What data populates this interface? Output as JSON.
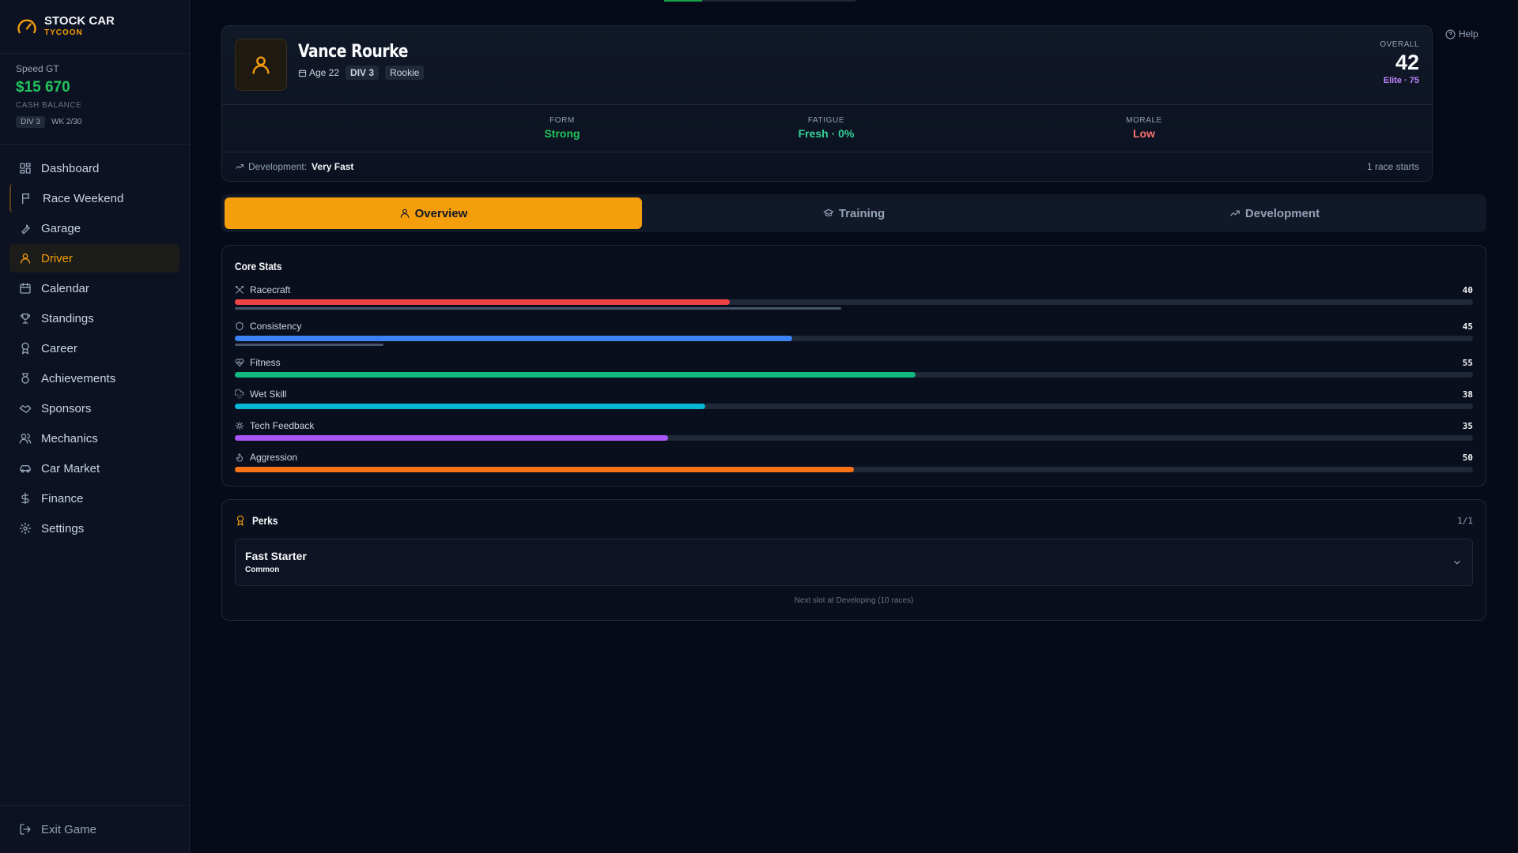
{
  "app": {
    "title": "STOCK CAR",
    "subtitle": "TYCOON"
  },
  "account": {
    "team": "Speed GT",
    "cash": "$15 670",
    "cash_label": "CASH BALANCE",
    "division": "DIV 3",
    "week": "WK 2/30"
  },
  "nav": [
    {
      "label": "Dashboard",
      "icon": "dashboard-icon"
    },
    {
      "label": "Race Weekend",
      "icon": "flag-icon"
    },
    {
      "label": "Garage",
      "icon": "wrench-icon"
    },
    {
      "label": "Driver",
      "icon": "user-icon",
      "active": true
    },
    {
      "label": "Calendar",
      "icon": "calendar-icon"
    },
    {
      "label": "Standings",
      "icon": "trophy-icon"
    },
    {
      "label": "Career",
      "icon": "award-icon"
    },
    {
      "label": "Achievements",
      "icon": "medal-icon"
    },
    {
      "label": "Sponsors",
      "icon": "handshake-icon"
    },
    {
      "label": "Mechanics",
      "icon": "users-icon"
    },
    {
      "label": "Car Market",
      "icon": "car-icon"
    },
    {
      "label": "Finance",
      "icon": "dollar-icon"
    },
    {
      "label": "Settings",
      "icon": "gear-icon"
    }
  ],
  "exit_label": "Exit Game",
  "help_label": "Help",
  "driver": {
    "name": "Vance Rourke",
    "age": "Age 22",
    "division": "DIV 3",
    "status": "Rookie",
    "overall_label": "OVERALL",
    "overall": "42",
    "tier": "Elite · 75",
    "form_label": "FORM",
    "form": "Strong",
    "fatigue_label": "FATIGUE",
    "fatigue": "Fresh · 0%",
    "morale_label": "MORALE",
    "morale": "Low",
    "development_label": "Development:",
    "development": "Very Fast",
    "race_starts": "1 race starts"
  },
  "tabs": [
    {
      "label": "Overview",
      "icon": "user-icon",
      "active": true
    },
    {
      "label": "Training",
      "icon": "graduation-cap-icon"
    },
    {
      "label": "Development",
      "icon": "trending-up-icon"
    }
  ],
  "core_stats": {
    "title": "Core Stats",
    "stats": [
      {
        "name": "Racecraft",
        "icon": "swords-icon",
        "value": "40",
        "fraction": 0.4,
        "color": "#ef4444",
        "potential_fraction": 0.49
      },
      {
        "name": "Consistency",
        "icon": "shield-icon",
        "value": "45",
        "fraction": 0.45,
        "color": "#3b82f6",
        "potential_fraction": 0.12
      },
      {
        "name": "Fitness",
        "icon": "heart-pulse-icon",
        "value": "55",
        "fraction": 0.55,
        "color": "#10b981"
      },
      {
        "name": "Wet Skill",
        "icon": "cloud-rain-icon",
        "value": "38",
        "fraction": 0.38,
        "color": "#06b6d4"
      },
      {
        "name": "Tech Feedback",
        "icon": "cog-icon",
        "value": "35",
        "fraction": 0.35,
        "color": "#a855f7"
      },
      {
        "name": "Aggression",
        "icon": "flame-icon",
        "value": "50",
        "fraction": 0.5,
        "color": "#f97316"
      }
    ]
  },
  "perks": {
    "title": "Perks",
    "count": "1/1",
    "items": [
      {
        "name": "Fast Starter",
        "rarity": "Common"
      }
    ],
    "next_slot": "Next slot at Developing (10 races)"
  },
  "colors": {
    "accent": "#f59e0b",
    "cash": "#22c55e",
    "form": "#22c55e",
    "fatigue": "#34d399",
    "morale": "#f87171",
    "tier": "#c084fc"
  }
}
